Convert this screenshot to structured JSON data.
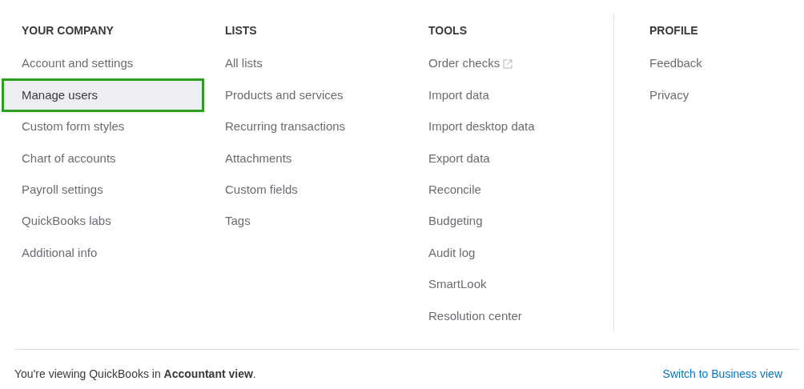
{
  "columns": [
    {
      "heading": "YOUR COMPANY",
      "items": [
        {
          "label": "Account and settings",
          "selected": false
        },
        {
          "label": "Manage users",
          "selected": true
        },
        {
          "label": "Custom form styles",
          "selected": false
        },
        {
          "label": "Chart of accounts",
          "selected": false
        },
        {
          "label": "Payroll settings",
          "selected": false
        },
        {
          "label": "QuickBooks labs",
          "selected": false
        },
        {
          "label": "Additional info",
          "selected": false
        }
      ]
    },
    {
      "heading": "LISTS",
      "items": [
        {
          "label": "All lists",
          "selected": false
        },
        {
          "label": "Products and services",
          "selected": false
        },
        {
          "label": "Recurring transactions",
          "selected": false
        },
        {
          "label": "Attachments",
          "selected": false
        },
        {
          "label": "Custom fields",
          "selected": false
        },
        {
          "label": "Tags",
          "selected": false
        }
      ]
    },
    {
      "heading": "TOOLS",
      "items": [
        {
          "label": "Order checks",
          "selected": false,
          "external_link": true
        },
        {
          "label": "Import data",
          "selected": false
        },
        {
          "label": "Import desktop data",
          "selected": false
        },
        {
          "label": "Export data",
          "selected": false
        },
        {
          "label": "Reconcile",
          "selected": false
        },
        {
          "label": "Budgeting",
          "selected": false
        },
        {
          "label": "Audit log",
          "selected": false
        },
        {
          "label": "SmartLook",
          "selected": false
        },
        {
          "label": "Resolution center",
          "selected": false
        }
      ]
    },
    {
      "heading": "PROFILE",
      "items": [
        {
          "label": "Feedback",
          "selected": false
        },
        {
          "label": "Privacy",
          "selected": false
        }
      ]
    }
  ],
  "footer": {
    "text": "You're viewing QuickBooks in **Accountant view**.",
    "link": "Switch to Business view"
  }
}
